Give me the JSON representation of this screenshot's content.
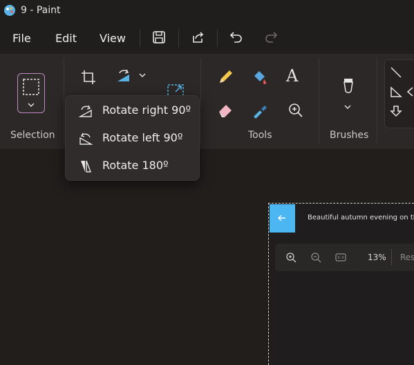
{
  "window": {
    "title": "9 - Paint"
  },
  "menubar": {
    "items": [
      "File",
      "Edit",
      "View"
    ],
    "icons": [
      "save-icon",
      "share-icon",
      "undo-icon",
      "redo-icon"
    ]
  },
  "ribbon": {
    "groups": {
      "selection": "Selection",
      "tools": "Tools",
      "brushes": "Brushes"
    }
  },
  "rotate_menu": {
    "items": [
      {
        "label": "Rotate right 90º",
        "icon": "rotate-right-icon"
      },
      {
        "label": "Rotate left 90º",
        "icon": "rotate-left-icon"
      },
      {
        "label": "Rotate 180º",
        "icon": "rotate-180-icon"
      }
    ]
  },
  "canvas_image": {
    "header_text": "Beautiful autumn evening on th",
    "zoom": "13%",
    "reset_text": "Res"
  },
  "colors": {
    "accent_blue": "#4bb6f2",
    "background": "#231f1e",
    "ribbon": "#2b2827"
  }
}
